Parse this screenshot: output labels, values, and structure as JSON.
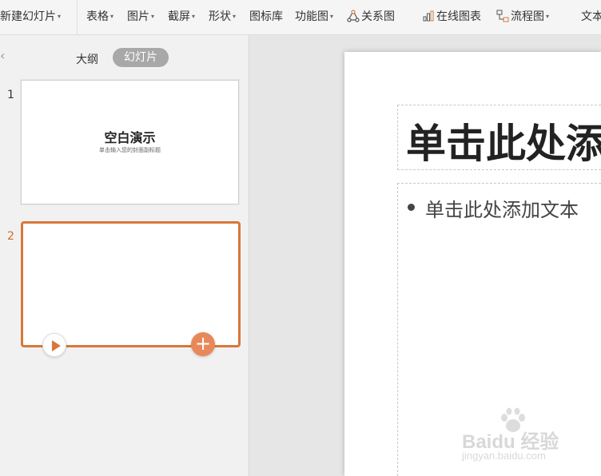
{
  "toolbar": {
    "items": [
      {
        "label": "新建幻灯片",
        "has_arrow": true
      },
      {
        "label": "表格",
        "has_arrow": true
      },
      {
        "label": "图片",
        "has_arrow": true
      },
      {
        "label": "截屏",
        "has_arrow": true
      },
      {
        "label": "形状",
        "has_arrow": true
      },
      {
        "label": "图标库",
        "has_arrow": false
      },
      {
        "label": "功能图",
        "has_arrow": true
      },
      {
        "label": "关系图",
        "has_arrow": false,
        "icon": "relation-icon"
      },
      {
        "label": "在线图表",
        "has_arrow": false,
        "icon": "chart-icon"
      },
      {
        "label": "流程图",
        "has_arrow": true,
        "icon": "flowchart-icon"
      },
      {
        "label": "文本",
        "has_arrow": false
      }
    ],
    "arrow_glyph": "▾"
  },
  "left_pane": {
    "collapse_glyph": "‹",
    "tabs": {
      "outline": "大纲",
      "slides": "幻灯片"
    },
    "slides": [
      {
        "number": "1",
        "title": "空白演示",
        "subtitle": "单击输入您的封面副标题"
      },
      {
        "number": "2",
        "title": "",
        "subtitle": ""
      }
    ],
    "add_glyph": "+"
  },
  "slide_editor": {
    "title_placeholder": "单击此处添加标题",
    "body_placeholder": "单击此处添加文本"
  },
  "watermark": {
    "brand": "Baidu 经验",
    "url": "jingyan.baidu.com"
  },
  "colors": {
    "accent": "#d9773a",
    "add_button": "#e8885a",
    "tab_active_bg": "#a8a8a8"
  }
}
